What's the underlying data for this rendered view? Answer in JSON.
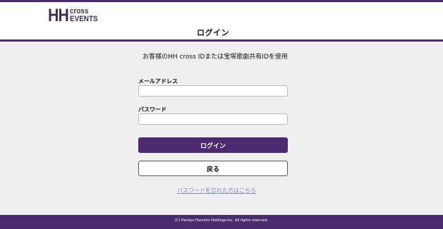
{
  "header": {
    "logo": {
      "mark": "HH",
      "line1": "cross",
      "line2": "EVENTS"
    },
    "title": "ログイン"
  },
  "form": {
    "intro": "お客様のHH cross IDまたは宝塚歌劇共有IDを使用",
    "email_label": "メールアドレス",
    "email_value": "",
    "password_label": "パスワード",
    "password_value": "",
    "login_button": "ログイン",
    "back_button": "戻る",
    "forgot_link": "パスワードを忘れた方はこちら"
  },
  "footer": {
    "copyright": "(C) Hankyu Hanshin Holdings,Inc. All rights reserved."
  },
  "colors": {
    "brand": "#4b2a6f",
    "link": "#8a86c9",
    "page_bg": "#efefef"
  }
}
